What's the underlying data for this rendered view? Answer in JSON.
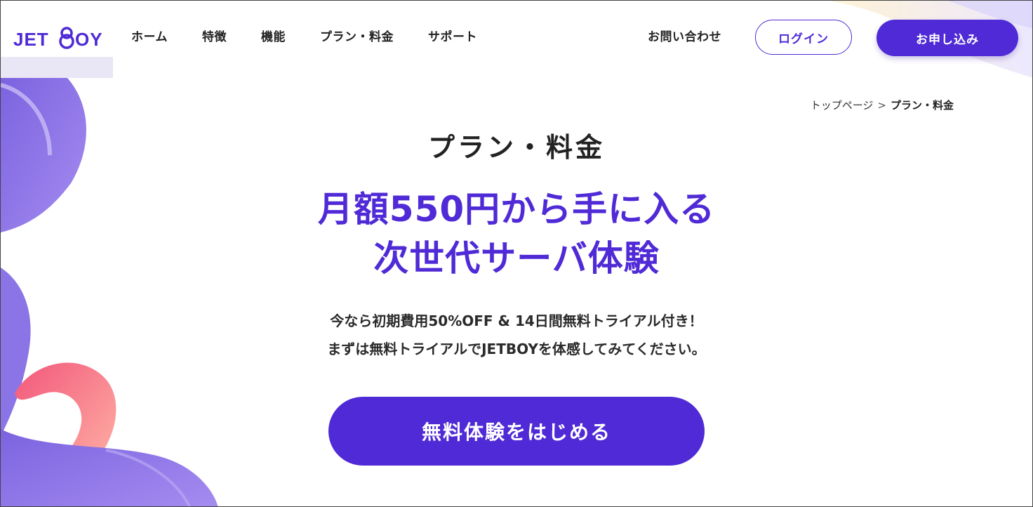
{
  "brand": {
    "logo_text": "JETBOY",
    "accent": "#4f2ad6",
    "text_color": "#222222"
  },
  "nav": {
    "items": [
      {
        "label": "ホーム"
      },
      {
        "label": "特徴"
      },
      {
        "label": "機能"
      },
      {
        "label": "プラン・料金"
      },
      {
        "label": "サポート"
      }
    ],
    "contact": "お問い合わせ",
    "login": "ログイン",
    "apply": "お申し込み"
  },
  "breadcrumb": {
    "home": "トップページ",
    "separator": ">",
    "current": "プラン・料金"
  },
  "hero": {
    "title": "プラン・料金",
    "headline_line1": "月額550円から手に入る",
    "headline_line2": "次世代サーバ体験",
    "sub_line1": "今なら初期費用50%OFF & 14日間無料トライアル付き！",
    "sub_line2": "まずは無料トライアルでJETBOYを体感してみてください。",
    "cta": "無料体験をはじめる"
  }
}
